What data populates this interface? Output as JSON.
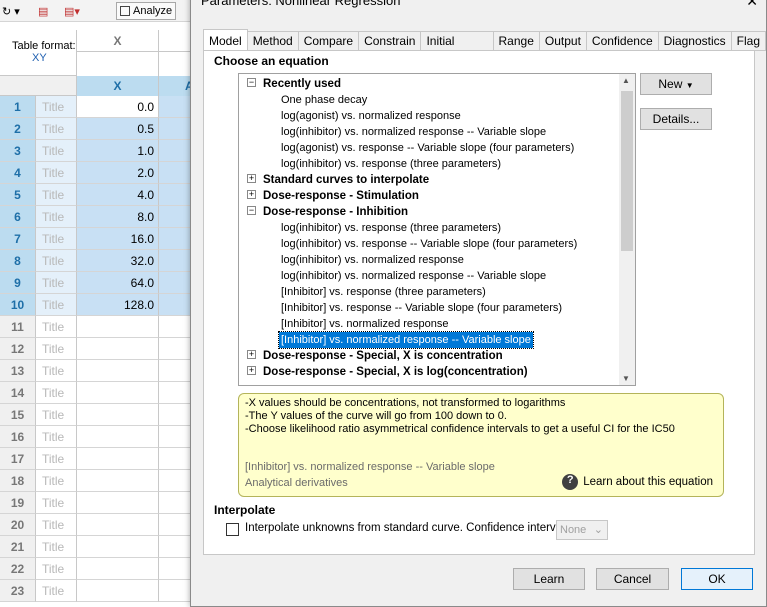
{
  "toolbar": {
    "analyze_label": "Analyze"
  },
  "table": {
    "format_label": "Table format:",
    "format_value": "XY",
    "col_header_top": "X",
    "col_header_x": "X",
    "col_header_y": "A",
    "title_placeholder": "Title",
    "rows": [
      {
        "num": "1",
        "x": "0.0"
      },
      {
        "num": "2",
        "x": "0.5"
      },
      {
        "num": "3",
        "x": "1.0"
      },
      {
        "num": "4",
        "x": "2.0"
      },
      {
        "num": "5",
        "x": "4.0"
      },
      {
        "num": "6",
        "x": "8.0"
      },
      {
        "num": "7",
        "x": "16.0"
      },
      {
        "num": "8",
        "x": "32.0"
      },
      {
        "num": "9",
        "x": "64.0"
      },
      {
        "num": "10",
        "x": "128.0"
      },
      {
        "num": "11",
        "x": ""
      },
      {
        "num": "12",
        "x": ""
      },
      {
        "num": "13",
        "x": ""
      },
      {
        "num": "14",
        "x": ""
      },
      {
        "num": "15",
        "x": ""
      },
      {
        "num": "16",
        "x": ""
      },
      {
        "num": "17",
        "x": ""
      },
      {
        "num": "18",
        "x": ""
      },
      {
        "num": "19",
        "x": ""
      },
      {
        "num": "20",
        "x": ""
      },
      {
        "num": "21",
        "x": ""
      },
      {
        "num": "22",
        "x": ""
      },
      {
        "num": "23",
        "x": ""
      }
    ]
  },
  "dialog": {
    "title": "Parameters: Nonlinear Regression",
    "close": "✕",
    "tabs": [
      "Model",
      "Method",
      "Compare",
      "Constrain",
      "Initial values",
      "Range",
      "Output",
      "Confidence",
      "Diagnostics",
      "Flag"
    ],
    "choose_label": "Choose an equation",
    "tree": [
      {
        "type": "g",
        "exp": "−",
        "label": "Recently used"
      },
      {
        "type": "l",
        "label": "One phase decay"
      },
      {
        "type": "l",
        "label": "log(agonist) vs. normalized response"
      },
      {
        "type": "l",
        "label": "log(inhibitor) vs. normalized response -- Variable slope"
      },
      {
        "type": "l",
        "label": "log(agonist) vs. response -- Variable slope (four parameters)"
      },
      {
        "type": "l",
        "label": "log(inhibitor) vs. response (three parameters)"
      },
      {
        "type": "g",
        "exp": "+",
        "label": "Standard curves to interpolate"
      },
      {
        "type": "g",
        "exp": "+",
        "label": "Dose-response - Stimulation"
      },
      {
        "type": "g",
        "exp": "−",
        "label": "Dose-response - Inhibition"
      },
      {
        "type": "l",
        "label": "log(inhibitor) vs. response (three parameters)"
      },
      {
        "type": "l",
        "label": "log(inhibitor) vs. response -- Variable slope (four parameters)"
      },
      {
        "type": "l",
        "label": "log(inhibitor) vs. normalized response"
      },
      {
        "type": "l",
        "label": "log(inhibitor) vs. normalized response -- Variable slope"
      },
      {
        "type": "l",
        "label": "[Inhibitor] vs. response (three parameters)"
      },
      {
        "type": "l",
        "label": "[Inhibitor] vs. response -- Variable slope (four parameters)"
      },
      {
        "type": "l",
        "label": "[Inhibitor] vs. normalized response"
      },
      {
        "type": "hl",
        "label": "[Inhibitor] vs. normalized response -- Variable slope"
      },
      {
        "type": "g",
        "exp": "+",
        "label": "Dose-response - Special, X is concentration"
      },
      {
        "type": "g",
        "exp": "+",
        "label": "Dose-response - Special, X is log(concentration)"
      }
    ],
    "new_button": "New",
    "details_button": "Details...",
    "desc_lines": [
      "-X values should be concentrations, not transformed to logarithms",
      "-The Y values of the curve will go from 100 down to 0.",
      "-Choose likelihood ratio asymmetrical confidence intervals to get a useful CI for the IC50"
    ],
    "desc_equation": "[Inhibitor] vs. normalized response -- Variable slope",
    "desc_method": "Analytical derivatives",
    "learn_equation": "Learn about this equation",
    "interpolate_label": "Interpolate",
    "interpolate_cb_label": "Interpolate unknowns from standard curve. Confidence interval:",
    "confidence_value": "None",
    "buttons": {
      "learn": "Learn",
      "cancel": "Cancel",
      "ok": "OK"
    }
  }
}
